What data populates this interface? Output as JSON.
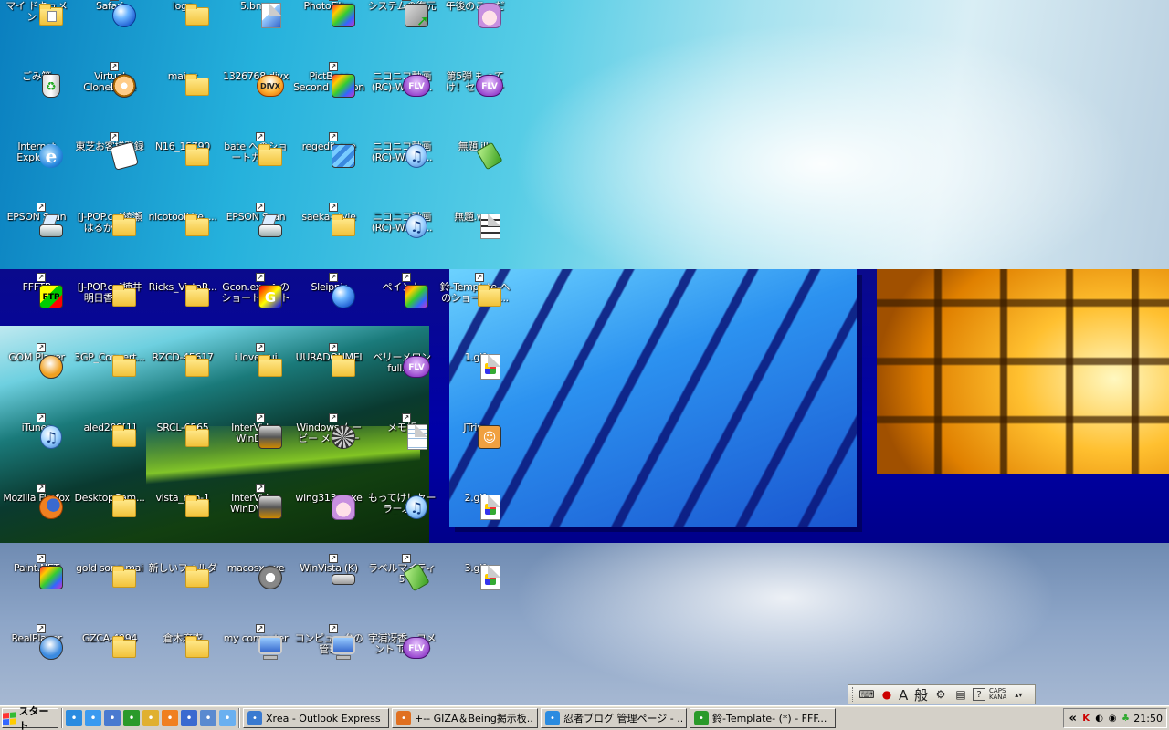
{
  "desktop": {
    "icons": [
      {
        "label": "マイ ドキュメント",
        "icon": "my-documents-icon",
        "shortcut": false
      },
      {
        "label": "ごみ箱",
        "icon": "recycle-bin-icon",
        "shortcut": false
      },
      {
        "label": "Internet Explorer",
        "icon": "internet-explorer-icon",
        "shortcut": false
      },
      {
        "label": "EPSON Scan",
        "icon": "scanner-icon",
        "shortcut": true
      },
      {
        "label": "FFFTP",
        "icon": "ffftp-icon",
        "shortcut": true
      },
      {
        "label": "GOM Player",
        "icon": "gom-player-icon",
        "shortcut": true
      },
      {
        "label": "iTunes",
        "icon": "itunes-icon",
        "shortcut": true
      },
      {
        "label": "Mozilla Firefox",
        "icon": "firefox-icon",
        "shortcut": true
      },
      {
        "label": "Paint.NET",
        "icon": "paint-net-icon",
        "shortcut": true
      },
      {
        "label": "RealPlayer",
        "icon": "realplayer-icon",
        "shortcut": true
      },
      {
        "label": "Safari",
        "icon": "safari-icon",
        "shortcut": true
      },
      {
        "label": "Virtual CloneDrive",
        "icon": "virtual-clonedrive-icon",
        "shortcut": true
      },
      {
        "label": "東芝お客様登録",
        "icon": "toshiba-registration-icon",
        "shortcut": true
      },
      {
        "label": "[J-POP.cn]綾瀬はるか(Ay...",
        "icon": "folder-icon",
        "shortcut": false
      },
      {
        "label": "[J-POP.cn]楠井明日香(Hi...",
        "icon": "folder-icon",
        "shortcut": false
      },
      {
        "label": "3GP_Convert...",
        "icon": "folder-icon",
        "shortcut": false
      },
      {
        "label": "aled208[1]",
        "icon": "folder-icon",
        "shortcut": false
      },
      {
        "label": "DesktopCam...",
        "icon": "folder-icon",
        "shortcut": false
      },
      {
        "label": "gold song mai",
        "icon": "folder-icon",
        "shortcut": false
      },
      {
        "label": "GZCA-4094",
        "icon": "folder-icon",
        "shortcut": false
      },
      {
        "label": "logo",
        "icon": "folder-icon",
        "shortcut": false
      },
      {
        "label": "mai rc",
        "icon": "folder-icon",
        "shortcut": false
      },
      {
        "label": "N16_15790",
        "icon": "folder-icon",
        "shortcut": false
      },
      {
        "label": "nicotoolLite_...",
        "icon": "folder-icon",
        "shortcut": false
      },
      {
        "label": "Ricks_VistaR...",
        "icon": "folder-icon",
        "shortcut": false
      },
      {
        "label": "RZCD-45617",
        "icon": "folder-icon",
        "shortcut": false
      },
      {
        "label": "SRCL-6565",
        "icon": "folder-icon",
        "shortcut": false
      },
      {
        "label": "vista_rtm-1",
        "icon": "folder-icon",
        "shortcut": false
      },
      {
        "label": "新しいフォルダ",
        "icon": "folder-icon",
        "shortcut": false
      },
      {
        "label": "倉木麻衣",
        "icon": "folder-icon",
        "shortcut": false
      },
      {
        "label": "5.bmp",
        "icon": "bitmap-file-icon",
        "shortcut": false
      },
      {
        "label": "1326768.divx",
        "icon": "divx-file-icon",
        "shortcut": false
      },
      {
        "label": "bate へのショートカット",
        "icon": "folder-icon",
        "shortcut": true
      },
      {
        "label": "EPSON Scan",
        "icon": "scanner-icon",
        "shortcut": true
      },
      {
        "label": "Gcon.exe へのショートカット",
        "icon": "gcon-icon",
        "shortcut": true
      },
      {
        "label": "i love yui",
        "icon": "folder-icon",
        "shortcut": true
      },
      {
        "label": "InterVideo WinDVD",
        "icon": "windvd-icon",
        "shortcut": true
      },
      {
        "label": "InterVideo WinDVD ...",
        "icon": "windvd-icon",
        "shortcut": true
      },
      {
        "label": "macosx.exe",
        "icon": "macosx-exe-icon",
        "shortcut": false
      },
      {
        "label": "my computer",
        "icon": "my-computer-icon",
        "shortcut": true
      },
      {
        "label": "PhotoFiltre",
        "icon": "photofiltre-icon",
        "shortcut": true
      },
      {
        "label": "PictBear Second Edition",
        "icon": "pictbear-icon",
        "shortcut": true
      },
      {
        "label": "regedit.exe",
        "icon": "regedit-icon",
        "shortcut": true
      },
      {
        "label": "saeka-style",
        "icon": "folder-icon",
        "shortcut": true
      },
      {
        "label": "Sleipnir",
        "icon": "sleipnir-icon",
        "shortcut": true
      },
      {
        "label": "UURADOUMEI",
        "icon": "folder-icon",
        "shortcut": true
      },
      {
        "label": "Windows ムービー メーカー",
        "icon": "movie-maker-icon",
        "shortcut": true
      },
      {
        "label": "wing313a.exe",
        "icon": "anime-character-icon",
        "shortcut": false
      },
      {
        "label": "WinVista (K)",
        "icon": "drive-icon",
        "shortcut": true
      },
      {
        "label": "コンピュータの管理",
        "icon": "computer-management-icon",
        "shortcut": true
      },
      {
        "label": "システムの復元",
        "icon": "system-restore-icon",
        "shortcut": true
      },
      {
        "label": "ニコニコ動画(RC)-Winny...",
        "icon": "flv-file-icon",
        "shortcut": false
      },
      {
        "label": "ニコニコ動画(RC)-Winny...",
        "icon": "music-file-icon",
        "shortcut": false
      },
      {
        "label": "ニコニコ動画(RC)-Winny...",
        "icon": "music-file-icon",
        "shortcut": false
      },
      {
        "label": "ペイント",
        "icon": "paint-icon",
        "shortcut": true
      },
      {
        "label": "ベリーメロン full.flv",
        "icon": "flv-file-icon",
        "shortcut": false
      },
      {
        "label": "メモ帳",
        "icon": "notepad-icon",
        "shortcut": true
      },
      {
        "label": "もってけ！セーラーふく Full.mp3",
        "icon": "music-file-icon",
        "shortcut": false
      },
      {
        "label": "ラベルマイティ5",
        "icon": "label-tag-icon",
        "shortcut": true
      },
      {
        "label": "宇浦冴香 - コメント Talk.flv",
        "icon": "flv-file-icon",
        "shortcut": false
      },
      {
        "label": "午後のこ～だ",
        "icon": "anime-character-icon",
        "shortcut": false
      },
      {
        "label": "第5弾 もってけ！セーラーふ...",
        "icon": "flv-file-icon",
        "shortcut": false
      },
      {
        "label": "無題.jlb",
        "icon": "label-tag-icon",
        "shortcut": false
      },
      {
        "label": "無題.wcp",
        "icon": "wcp-file-icon",
        "shortcut": false
      },
      {
        "label": "鈴-Template-へのショートカ...",
        "icon": "folder-icon",
        "shortcut": true
      },
      {
        "label": "1.gif",
        "icon": "gif-file-icon",
        "shortcut": false
      },
      {
        "label": "JTrim",
        "icon": "jtrim-icon",
        "shortcut": false
      },
      {
        "label": "2.gif",
        "icon": "gif-file-icon",
        "shortcut": false
      },
      {
        "label": "3.gif",
        "icon": "gif-file-icon",
        "shortcut": false
      }
    ]
  },
  "language_bar": {
    "ime_mode": "A 般",
    "caps": "CAPS",
    "kana": "KANA"
  },
  "taskbar": {
    "start_label": "スタート",
    "quick_launch": [
      "internet-explorer-icon",
      "ie-icon",
      "outlook-express-icon",
      "ffftp-icon",
      "folder-icon",
      "firefox-icon",
      "explorer-icon",
      "outlook-icon",
      "itunes-icon"
    ],
    "tasks": [
      {
        "label": "Xrea - Outlook Express",
        "icon": "outlook-express-icon"
      },
      {
        "label": "+-- GIZA＆Being掲示板...",
        "icon": "firefox-icon"
      },
      {
        "label": "忍者ブログ 管理ページ - ...",
        "icon": "internet-explorer-icon"
      },
      {
        "label": "鈴-Template- (*) - FFF...",
        "icon": "ffftp-icon"
      }
    ],
    "tray_chevron": "«",
    "clock": "21:50"
  }
}
